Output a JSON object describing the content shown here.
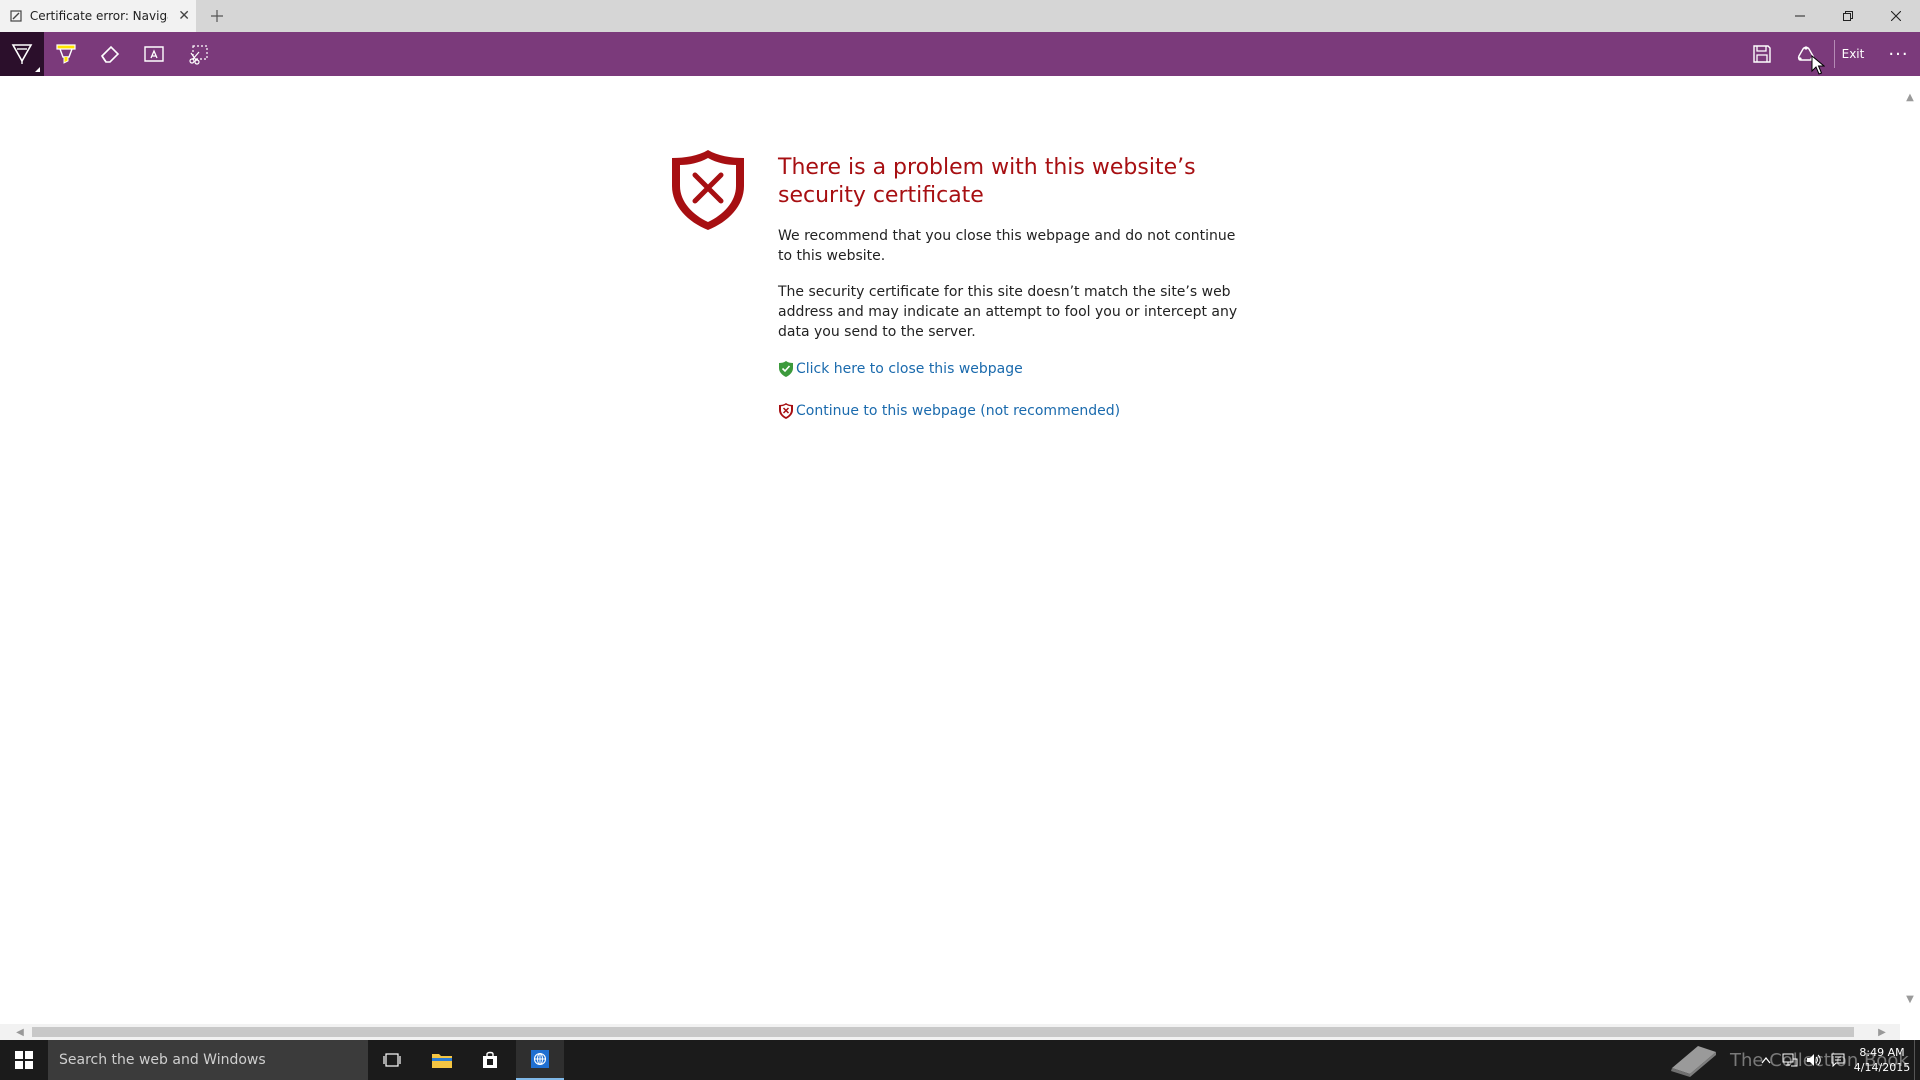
{
  "window": {
    "tab_title": "Certificate error: Navigatio",
    "tab_close_glyph": "✕",
    "controls": [
      "minimize",
      "restore",
      "close"
    ]
  },
  "note_toolbar": {
    "tools": [
      "pen",
      "highlighter",
      "eraser",
      "typed-note",
      "clip"
    ],
    "exit_label": "Exit",
    "more_label": "···"
  },
  "page": {
    "title": "There is a problem with this website’s security certificate",
    "para1": "We recommend that you close this webpage and do not continue to this website.",
    "para2": "The security certificate for this site doesn’t match the site’s web address and may indicate an attempt to fool you or intercept any data you send to the server.",
    "link_close": "Click here to close this webpage",
    "link_continue": "Continue to this webpage (not recommended)"
  },
  "taskbar": {
    "search_placeholder": "Search the web and Windows",
    "watermark": "The Collection Book",
    "clock_time": "8:49 AM",
    "clock_date": "4/14/2015"
  },
  "colors": {
    "note_toolbar_bg": "#7b3a7b",
    "error_red": "#a70f12",
    "link_blue": "#1a6aad",
    "safe_green": "#3c9a3c"
  }
}
